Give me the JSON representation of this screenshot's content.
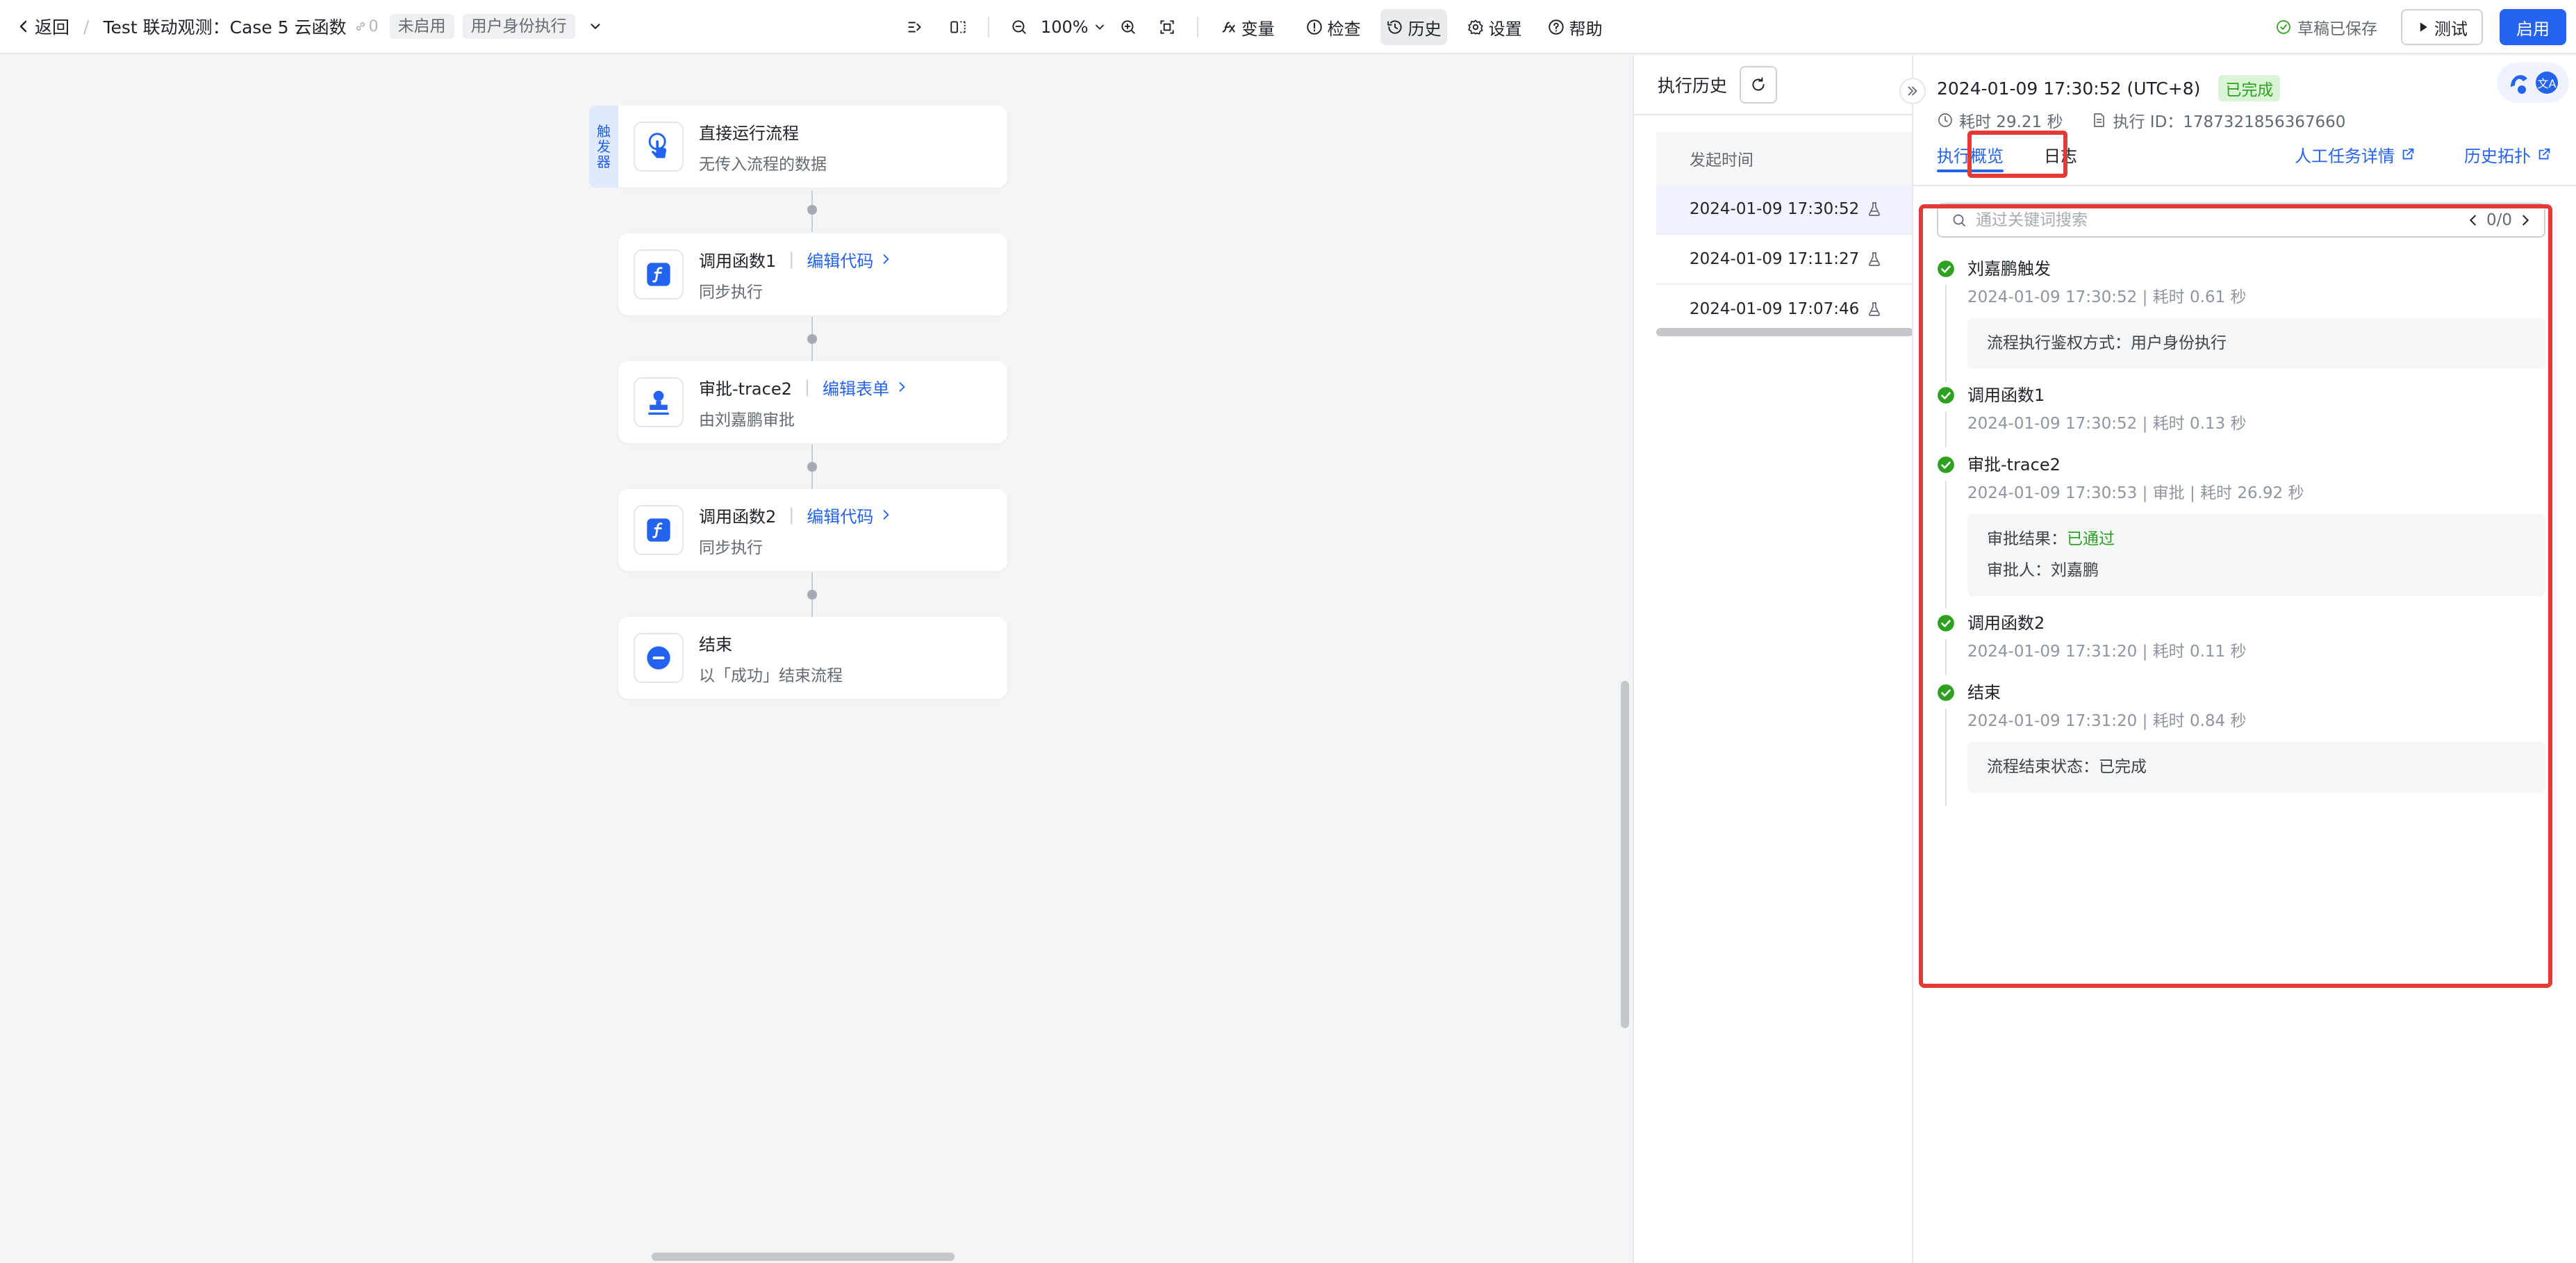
{
  "header": {
    "back_label": "返回",
    "separator": "/",
    "flow_title": "Test 联动观测：Case 5 云函数",
    "link_count": "0",
    "status_tag": "未启用",
    "auth_tag": "用户身份执行"
  },
  "toolbar": {
    "zoom": "100%",
    "variables": "变量",
    "check": "检查",
    "history": "历史",
    "settings": "设置",
    "help": "帮助"
  },
  "actions": {
    "saved_status": "草稿已保存",
    "test_label": "测试",
    "enable_label": "启用"
  },
  "canvas": {
    "trigger_tag": [
      "触",
      "发",
      "器"
    ],
    "nodes": [
      {
        "title": "直接运行流程",
        "subtitle": "无传入流程的数据",
        "link": ""
      },
      {
        "title": "调用函数1",
        "subtitle": "同步执行",
        "link": "编辑代码"
      },
      {
        "title": "审批-trace2",
        "subtitle": "由刘嘉鹏审批",
        "link": "编辑表单"
      },
      {
        "title": "调用函数2",
        "subtitle": "同步执行",
        "link": "编辑代码"
      },
      {
        "title": "结束",
        "subtitle": "以「成功」结束流程",
        "link": ""
      }
    ]
  },
  "history": {
    "title": "执行历史",
    "column_header": "发起时间",
    "rows": [
      {
        "time": "2024-01-09 17:30:52"
      },
      {
        "time": "2024-01-09 17:11:27"
      },
      {
        "time": "2024-01-09 17:07:46"
      }
    ]
  },
  "detail": {
    "time": "2024-01-09 17:30:52 (UTC+8)",
    "status": "已完成",
    "duration": "耗时 29.21 秒",
    "exec_id": "执行 ID：1787321856367660",
    "tabs": [
      {
        "label": "执行概览"
      },
      {
        "label": "日志"
      }
    ],
    "links": {
      "manual_tasks": "人工任务详情",
      "history_topology": "历史拓扑"
    },
    "search": {
      "placeholder": "通过关键词搜索",
      "count": "0/0"
    },
    "steps": [
      {
        "name": "刘嘉鹏触发",
        "meta": "2024-01-09 17:30:52 | 耗时 0.61 秒",
        "box": [
          {
            "label": "流程执行鉴权方式：",
            "value": "用户身份执行"
          }
        ]
      },
      {
        "name": "调用函数1",
        "meta": "2024-01-09 17:30:52 | 耗时 0.13 秒",
        "box": []
      },
      {
        "name": "审批-trace2",
        "meta": "2024-01-09 17:30:53 | 审批 | 耗时 26.92 秒",
        "box": [
          {
            "label": "审批结果：",
            "value": "已通过"
          },
          {
            "label": "审批人：",
            "value": "刘嘉鹏"
          }
        ]
      },
      {
        "name": "调用函数2",
        "meta": "2024-01-09 17:31:20 | 耗时 0.11 秒",
        "box": []
      },
      {
        "name": "结束",
        "meta": "2024-01-09 17:31:20 | 耗时 0.84 秒",
        "box": [
          {
            "label": "流程结束状态：",
            "value": "已完成"
          }
        ]
      }
    ]
  },
  "colors": {
    "primary": "#2462f0",
    "success": "#2ea121",
    "highlight_border": "#e53935"
  },
  "icons": {
    "back": "chevron-left-icon",
    "link": "link-icon",
    "dropdown": "chevron-down-icon",
    "layout": "align-icon",
    "split": "split-view-icon",
    "zoom_out": "zoom-out-icon",
    "zoom_in": "zoom-in-icon",
    "fit": "fit-screen-icon",
    "variables": "variable-icon",
    "check": "info-circle-icon",
    "history": "history-clock-icon",
    "settings": "gear-icon",
    "help": "question-circle-icon",
    "saved": "check-circle-icon",
    "play": "play-icon",
    "refresh": "refresh-icon",
    "flask": "flask-icon",
    "clock": "clock-icon",
    "document": "document-icon",
    "external": "external-link-icon",
    "search": "search-icon",
    "success": "success-check-icon"
  }
}
